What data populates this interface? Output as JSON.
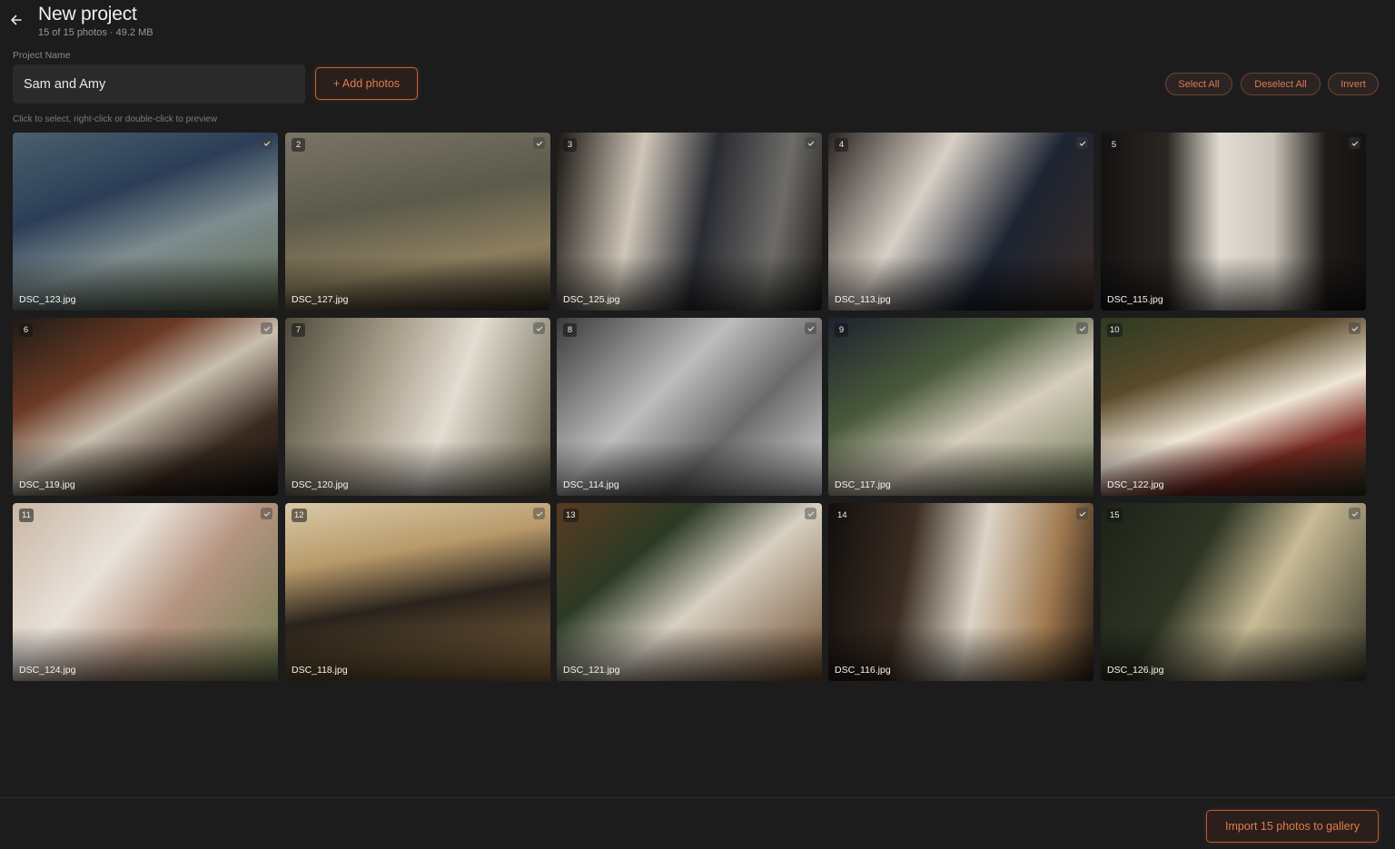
{
  "header": {
    "back_icon": "arrow-left-icon",
    "title": "New project",
    "subtitle": "15 of 15 photos · 49.2 MB"
  },
  "form": {
    "project_name_label": "Project Name",
    "project_name_value": "Sam and Amy",
    "add_photos_label": "+ Add photos",
    "hint": "Click to select, right-click or double-click to preview"
  },
  "selection": {
    "select_all": "Select All",
    "deselect_all": "Deselect All",
    "invert": "Invert"
  },
  "photos": [
    {
      "num": "",
      "file": "DSC_123.jpg",
      "selected": true
    },
    {
      "num": "2",
      "file": "DSC_127.jpg",
      "selected": true
    },
    {
      "num": "3",
      "file": "DSC_125.jpg",
      "selected": true
    },
    {
      "num": "4",
      "file": "DSC_113.jpg",
      "selected": true
    },
    {
      "num": "5",
      "file": "DSC_115.jpg",
      "selected": true
    },
    {
      "num": "6",
      "file": "DSC_119.jpg",
      "selected": true
    },
    {
      "num": "7",
      "file": "DSC_120.jpg",
      "selected": true
    },
    {
      "num": "8",
      "file": "DSC_114.jpg",
      "selected": true
    },
    {
      "num": "9",
      "file": "DSC_117.jpg",
      "selected": true
    },
    {
      "num": "10",
      "file": "DSC_122.jpg",
      "selected": true
    },
    {
      "num": "11",
      "file": "DSC_124.jpg",
      "selected": true
    },
    {
      "num": "12",
      "file": "DSC_118.jpg",
      "selected": true
    },
    {
      "num": "13",
      "file": "DSC_121.jpg",
      "selected": true
    },
    {
      "num": "14",
      "file": "DSC_116.jpg",
      "selected": true
    },
    {
      "num": "15",
      "file": "DSC_126.jpg",
      "selected": true
    }
  ],
  "footer": {
    "import_label": "Import 15 photos to gallery"
  },
  "colors": {
    "background": "#1c1c1d",
    "accent": "#e07c4c",
    "accent_border": "#c4643a"
  }
}
